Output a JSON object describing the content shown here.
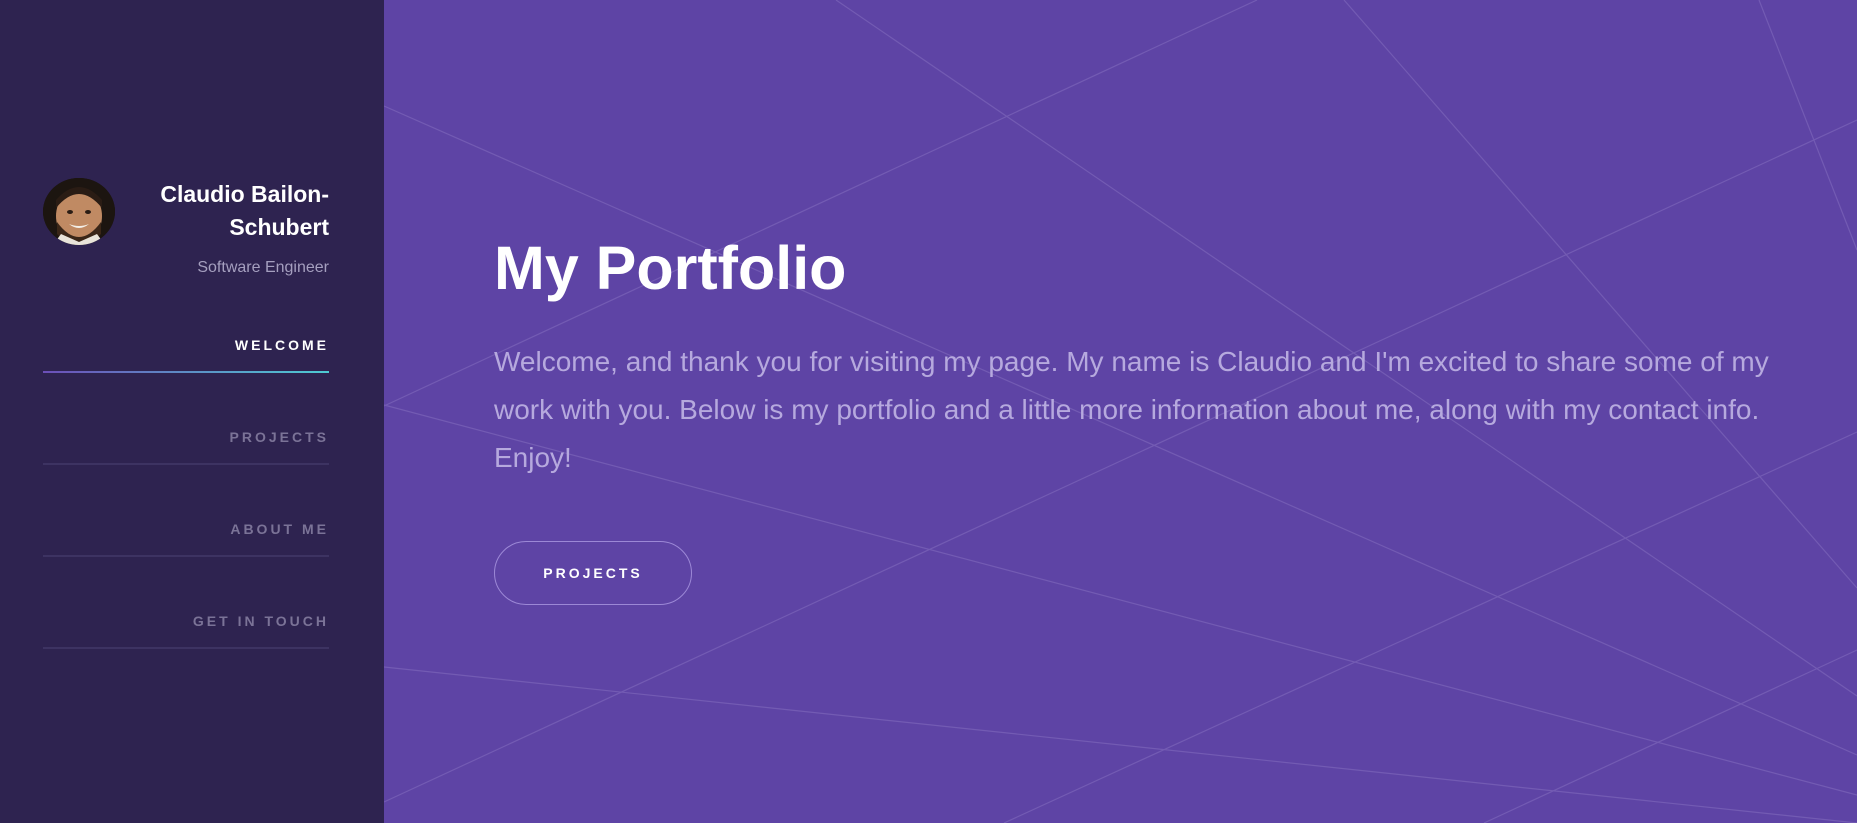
{
  "profile": {
    "name": "Claudio Bailon-Schubert",
    "role": "Software Engineer"
  },
  "nav": {
    "items": [
      {
        "label": "WELCOME",
        "active": true
      },
      {
        "label": "PROJECTS",
        "active": false
      },
      {
        "label": "ABOUT ME",
        "active": false
      },
      {
        "label": "GET IN TOUCH",
        "active": false
      }
    ]
  },
  "main": {
    "title": "My Portfolio",
    "intro": "Welcome, and thank you for visiting my page. My name is Claudio and I'm excited to share some of my work with you. Below is my portfolio and a little more information about me, along with my contact info. Enjoy!",
    "cta_label": "PROJECTS"
  },
  "colors": {
    "sidebar_bg": "#2e2350",
    "main_bg": "#5e44a5",
    "accent_gradient_start": "#6c4fb8",
    "accent_gradient_end": "#4ecbd3",
    "muted_text": "#7b7397"
  }
}
